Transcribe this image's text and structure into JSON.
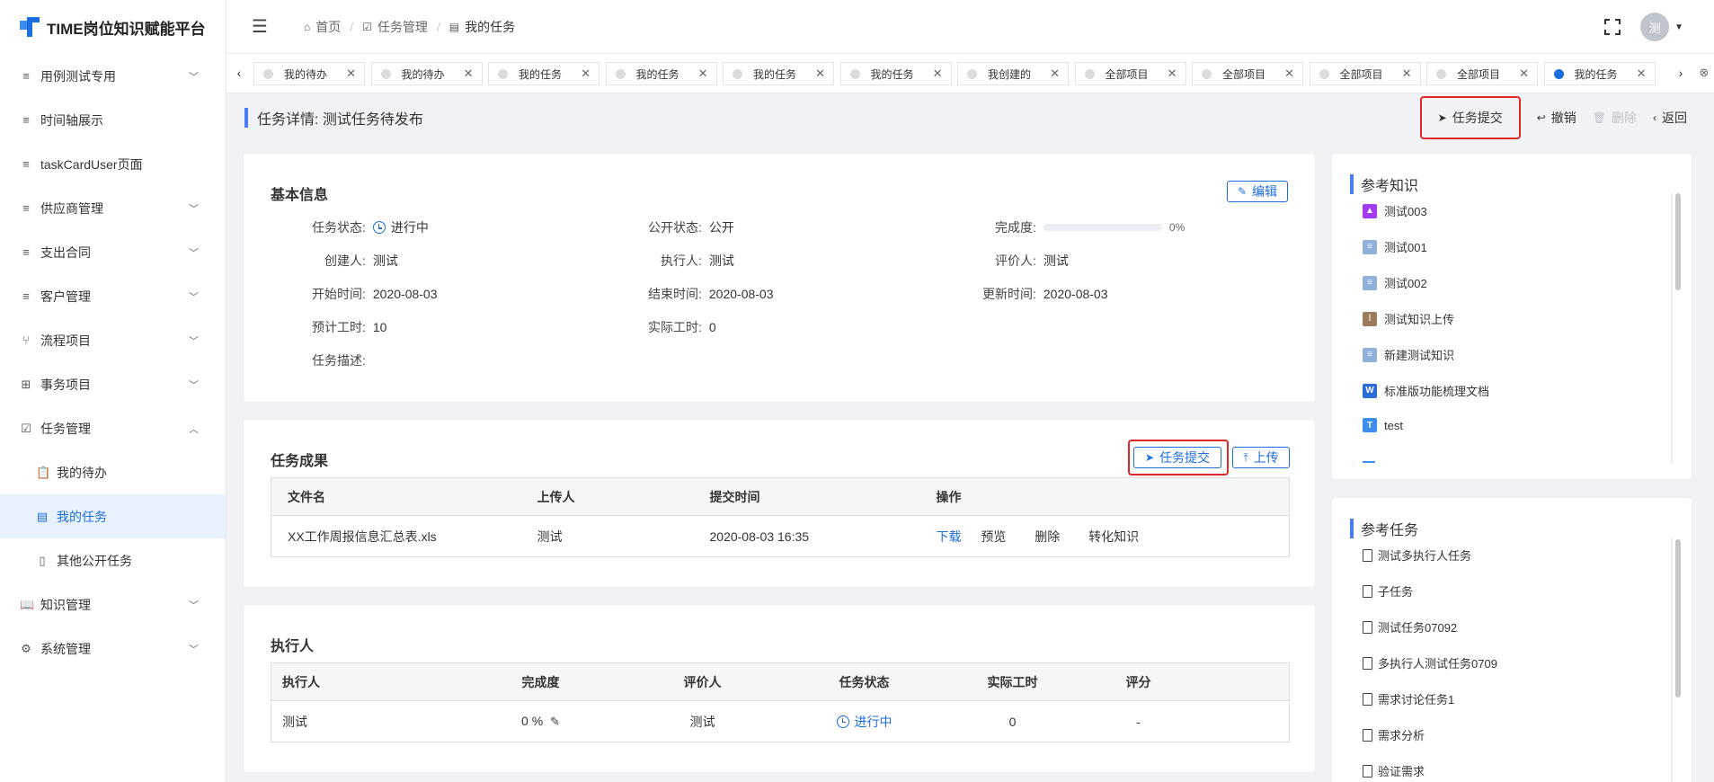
{
  "app": {
    "title": "TIME岗位知识赋能平台"
  },
  "sidebar": {
    "items": [
      {
        "label": "用例测试专用",
        "icon": "list-icon",
        "arrow": "v"
      },
      {
        "label": "时间轴展示",
        "icon": "list-icon",
        "arrow": ""
      },
      {
        "label": "taskCardUser页面",
        "icon": "list-icon",
        "arrow": ""
      },
      {
        "label": "供应商管理",
        "icon": "list-icon",
        "arrow": "v"
      },
      {
        "label": "支出合同",
        "icon": "list-icon",
        "arrow": "v"
      },
      {
        "label": "客户管理",
        "icon": "list-icon",
        "arrow": "v"
      },
      {
        "label": "流程项目",
        "icon": "branch-icon",
        "arrow": "v"
      },
      {
        "label": "事务项目",
        "icon": "grid-icon",
        "arrow": "v"
      },
      {
        "label": "任务管理",
        "icon": "checkbox-icon",
        "arrow": "^"
      },
      {
        "label": "我的待办",
        "icon": "clipboard-icon",
        "arrow": ""
      },
      {
        "label": "我的任务",
        "icon": "doc-list-icon",
        "arrow": ""
      },
      {
        "label": "其他公开任务",
        "icon": "doc-icon",
        "arrow": ""
      },
      {
        "label": "知识管理",
        "icon": "book-icon",
        "arrow": "v"
      },
      {
        "label": "系统管理",
        "icon": "gear-icon",
        "arrow": "v"
      }
    ]
  },
  "header": {
    "breadcrumb": [
      "首页",
      "任务管理",
      "我的任务"
    ],
    "avatar_text": "测"
  },
  "tabs": [
    "我的待办",
    "我的待办",
    "我的任务",
    "我的任务",
    "我的任务",
    "我的任务",
    "我创建的",
    "全部项目",
    "全部项目",
    "全部项目",
    "全部项目",
    "我的任务"
  ],
  "page": {
    "title": "任务详情: 测试任务待发布",
    "actions": {
      "submit": "任务提交",
      "revoke": "撤销",
      "delete": "删除",
      "back": "返回"
    }
  },
  "basic_info": {
    "title": "基本信息",
    "edit": "编辑",
    "fields": {
      "status_label": "任务状态:",
      "status_value": "进行中",
      "public_label": "公开状态:",
      "public_value": "公开",
      "completion_label": "完成度:",
      "completion_value": "0%",
      "completion_fraction": 0,
      "creator_label": "创建人:",
      "creator_value": "测试",
      "executor_label": "执行人:",
      "executor_value": "测试",
      "evaluator_label": "评价人:",
      "evaluator_value": "测试",
      "start_label": "开始时间:",
      "start_value": "2020-08-03",
      "end_label": "结束时间:",
      "end_value": "2020-08-03",
      "update_label": "更新时间:",
      "update_value": "2020-08-03",
      "est_hours_label": "预计工时:",
      "est_hours_value": "10",
      "actual_hours_label": "实际工时:",
      "actual_hours_value": "0",
      "desc_label": "任务描述:"
    }
  },
  "results": {
    "title": "任务成果",
    "submit": "任务提交",
    "upload": "上传",
    "columns": [
      "文件名",
      "上传人",
      "提交时间",
      "操作"
    ],
    "rows": [
      {
        "file": "XX工作周报信息汇总表.xls",
        "uploader": "测试",
        "time": "2020-08-03 16:35",
        "ops": [
          "下载",
          "预览",
          "删除",
          "转化知识"
        ]
      }
    ]
  },
  "executors": {
    "title": "执行人",
    "columns": [
      "执行人",
      "完成度",
      "评价人",
      "任务状态",
      "实际工时",
      "评分"
    ],
    "rows": [
      {
        "executor": "测试",
        "completion": "0 %",
        "evaluator": "测试",
        "status": "进行中",
        "hours": "0",
        "score": "-"
      }
    ]
  },
  "ref_knowledge": {
    "title": "参考知识",
    "items": [
      {
        "label": "测试003",
        "type": "image",
        "color": "#a33cf0",
        "glyph": ""
      },
      {
        "label": "测试001",
        "type": "text",
        "color": "#8fb0d8",
        "glyph": ""
      },
      {
        "label": "测试002",
        "type": "text",
        "color": "#8fb0d8",
        "glyph": ""
      },
      {
        "label": "测试知识上传",
        "type": "zip",
        "color": "#9a7b5a",
        "glyph": ""
      },
      {
        "label": "新建测试知识",
        "type": "text",
        "color": "#8fb0d8",
        "glyph": ""
      },
      {
        "label": "标准版功能梳理文档",
        "type": "word",
        "color": "#2b6cd9",
        "glyph": "W"
      },
      {
        "label": "test",
        "type": "t",
        "color": "#3d8ef0",
        "glyph": "T"
      }
    ]
  },
  "ref_tasks": {
    "title": "参考任务",
    "items": [
      "测试多执行人任务",
      "子任务",
      "测试任务07092",
      "多执行人测试任务0709",
      "需求讨论任务1",
      "需求分析",
      "验证需求"
    ]
  },
  "colors": {
    "accent": "#1c6ddd",
    "highlight": "#e02828",
    "title_bar": "#4a7cf6"
  }
}
